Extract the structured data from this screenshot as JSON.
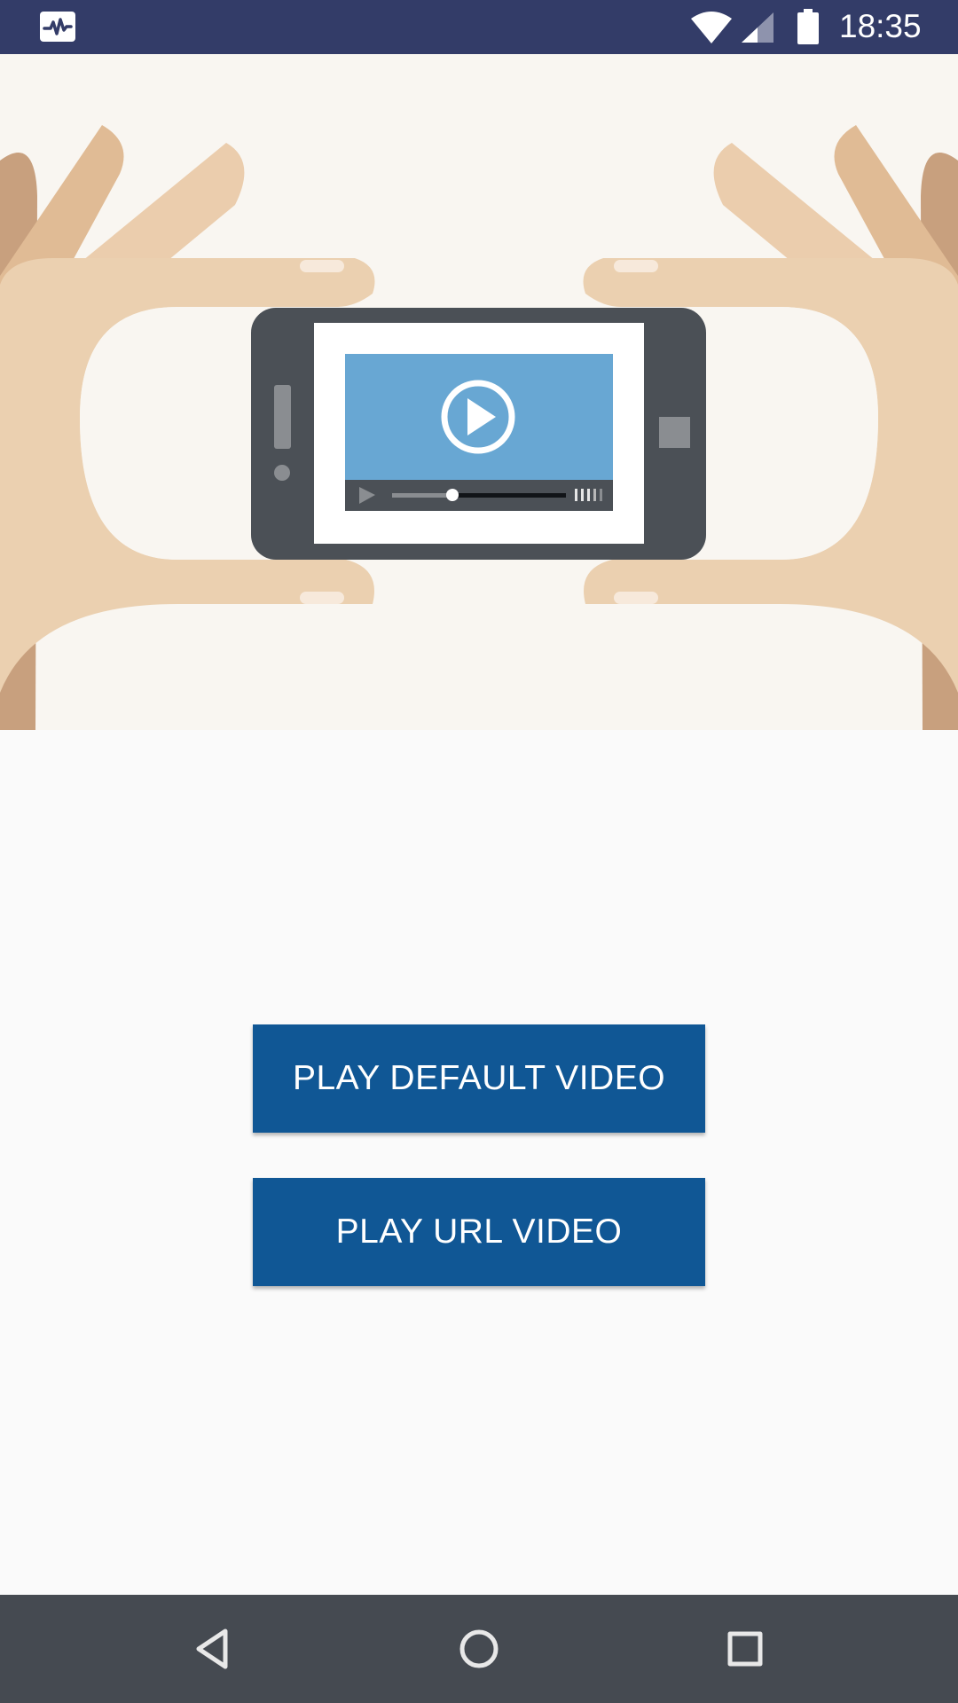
{
  "status_bar": {
    "time": "18:35",
    "icons": [
      "activity-monitor-icon",
      "wifi-icon",
      "cell-signal-icon",
      "battery-icon"
    ],
    "background": "#333c68"
  },
  "hero": {
    "illustration": "hands-holding-phone-with-video-player",
    "colors": {
      "skin": "#ebd0b0",
      "phone": "#4b5056",
      "video": "#68a7d3",
      "background": "#f9f6f1"
    }
  },
  "buttons": {
    "play_default": "PLAY DEFAULT VIDEO",
    "play_url": "PLAY URL VIDEO",
    "color": "#105795"
  },
  "nav_bar": {
    "icons": [
      "back-icon",
      "home-icon",
      "recents-icon"
    ],
    "background": "#454a51"
  }
}
